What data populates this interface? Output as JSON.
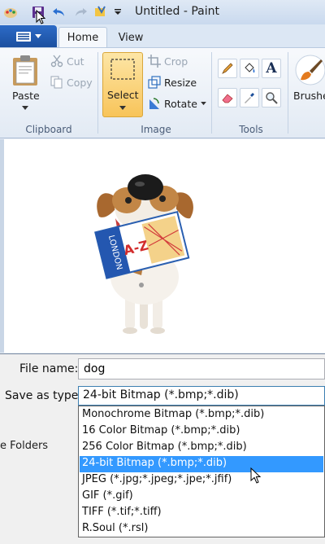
{
  "titlebar": {
    "title": "Untitled - Paint"
  },
  "tabs": {
    "home": "Home",
    "view": "View"
  },
  "ribbon": {
    "clipboard": {
      "label": "Clipboard",
      "paste": "Paste",
      "cut": "Cut",
      "copy": "Copy"
    },
    "image": {
      "label": "Image",
      "select": "Select",
      "crop": "Crop",
      "resize": "Resize",
      "rotate": "Rotate"
    },
    "tools": {
      "label": "Tools"
    },
    "brushes": "Brushes"
  },
  "dialog": {
    "file_name_label": "File name:",
    "file_name_value": "dog",
    "save_as_type_label": "Save as type:",
    "save_as_type_value": "24-bit Bitmap (*.bmp;*.dib)",
    "hide_folders": "e Folders",
    "options": [
      "Monochrome Bitmap (*.bmp;*.dib)",
      "16 Color Bitmap (*.bmp;*.dib)",
      "256 Color Bitmap (*.bmp;*.dib)",
      "24-bit Bitmap (*.bmp;*.dib)",
      "JPEG (*.jpg;*.jpeg;*.jpe;*.jfif)",
      "GIF (*.gif)",
      "TIFF (*.tif;*.tiff)",
      "R.Soul (*.rsl)"
    ],
    "selected_index": 3
  },
  "colors": {
    "accent": "#3399ff",
    "select_highlight": "#f8c45a",
    "file_menu": "#1b4f9e"
  },
  "canvas_image": {
    "book_text_1": "LONDON",
    "book_text_2": "A-Z"
  }
}
